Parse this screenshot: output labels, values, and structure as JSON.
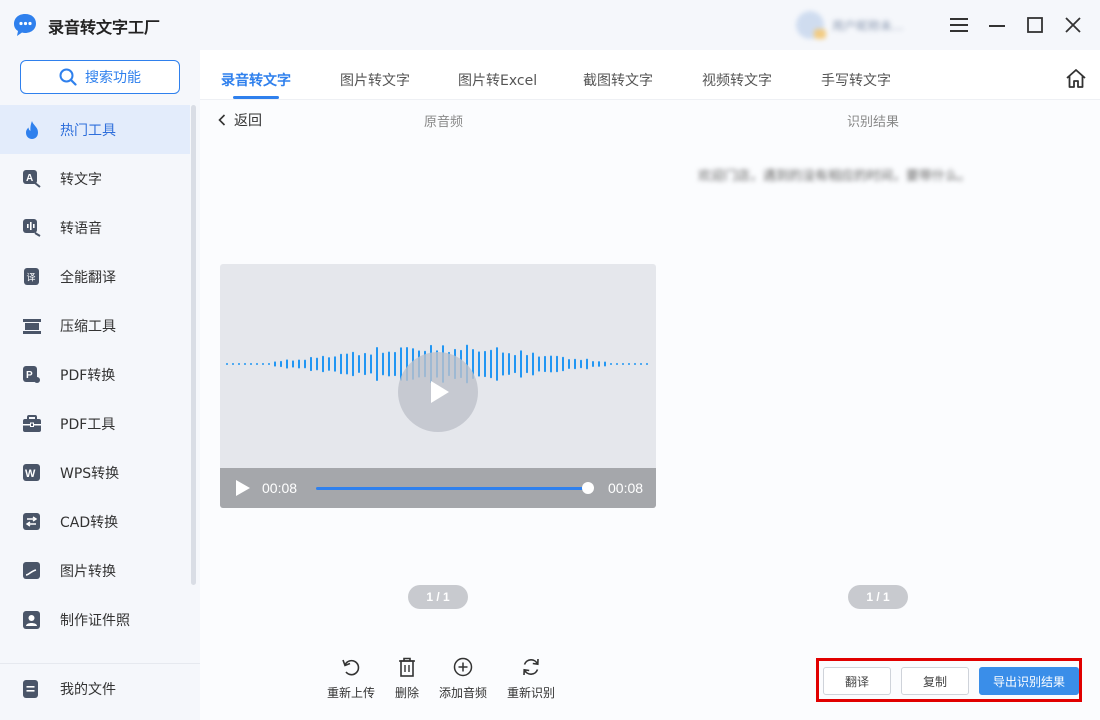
{
  "app": {
    "title": "录音转文字工厂",
    "user_name": "用户昵称未..."
  },
  "sidebar": {
    "search_label": "搜索功能",
    "items": [
      {
        "label": "热门工具",
        "icon": "flame-icon",
        "active": true
      },
      {
        "label": "转文字",
        "icon": "text-convert-icon"
      },
      {
        "label": "转语音",
        "icon": "voice-icon"
      },
      {
        "label": "全能翻译",
        "icon": "translate-icon"
      },
      {
        "label": "压缩工具",
        "icon": "compress-icon"
      },
      {
        "label": "PDF转换",
        "icon": "pdf-convert-icon"
      },
      {
        "label": "PDF工具",
        "icon": "toolbox-icon"
      },
      {
        "label": "WPS转换",
        "icon": "wps-icon"
      },
      {
        "label": "CAD转换",
        "icon": "cad-icon"
      },
      {
        "label": "图片转换",
        "icon": "image-icon"
      },
      {
        "label": "制作证件照",
        "icon": "id-photo-icon"
      }
    ],
    "my_files": "我的文件"
  },
  "tabs": [
    {
      "label": "录音转文字",
      "active": true
    },
    {
      "label": "图片转文字"
    },
    {
      "label": "图片转Excel"
    },
    {
      "label": "截图转文字"
    },
    {
      "label": "视频转文字"
    },
    {
      "label": "手写转文字"
    }
  ],
  "content": {
    "back_label": "返回",
    "original_audio_header": "原音频",
    "result_header": "识别结果",
    "result_text": "欢迎门店，遇到的没有相应的时间，要带什么。",
    "player": {
      "current_time": "00:08",
      "duration": "00:08",
      "progress": 1.0
    },
    "left_pager": "1 / 1",
    "right_pager": "1 / 1"
  },
  "actions": [
    {
      "label": "重新上传",
      "icon": "reupload-icon"
    },
    {
      "label": "删除",
      "icon": "trash-icon"
    },
    {
      "label": "添加音频",
      "icon": "add-circle-icon"
    },
    {
      "label": "重新识别",
      "icon": "refresh-icon"
    }
  ],
  "result_buttons": {
    "translate": "翻译",
    "copy": "复制",
    "export": "导出识别结果"
  },
  "colors": {
    "accent": "#2f80ed",
    "highlight_border": "#e10000"
  }
}
